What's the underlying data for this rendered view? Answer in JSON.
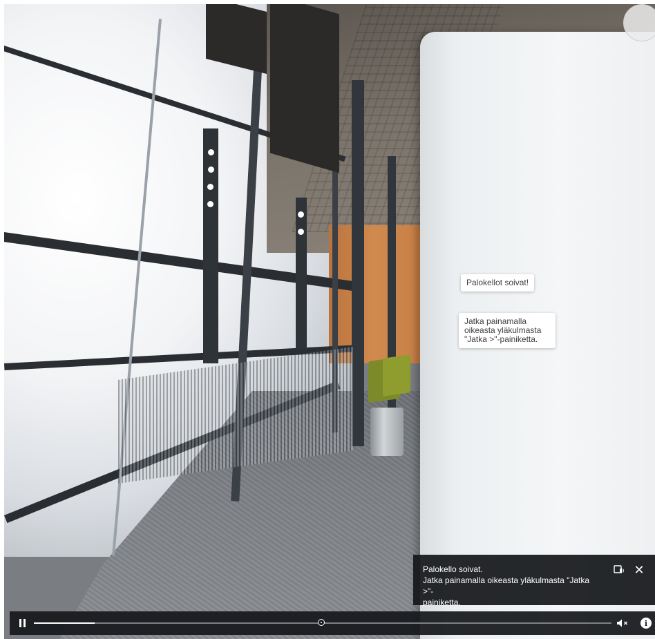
{
  "hotspots": [
    {
      "text": "Palokellot soivat!"
    },
    {
      "text": "Jatka painamalla\noikeasta yläkulmasta\n\"Jatka >\"-painiketta."
    }
  ],
  "caption": {
    "text": "Palokello soivat.\nJatka painamalla oikeasta yläkulmasta \"Jatka >\"-\npainiketta.",
    "cc_icon": "captions-icon",
    "close_label": "✕"
  },
  "player": {
    "play_state": "playing",
    "progress_fraction": 0.105,
    "buffered_marker_fraction": 0.498,
    "muted": true,
    "info_label": "i"
  },
  "colors": {
    "bar_bg": "#16181b",
    "bubble_bg": "#ffffff",
    "track": "#7d8185"
  }
}
